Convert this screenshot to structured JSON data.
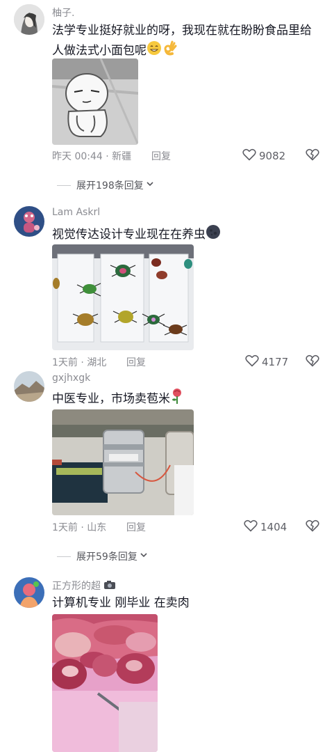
{
  "comments": [
    {
      "username": "柚子.",
      "text": "法学专业挺好就业的呀，我现在就在盼盼食品里给人做法式小面包呢",
      "meta": "昨天 00:44 · 新疆",
      "reply": "回复",
      "likes": "9082",
      "emojis": [
        "grin-emoji",
        "ok-hand-emoji"
      ]
    },
    {
      "username": "Lam Askrl",
      "text": "视觉传达设计专业现在在养虫",
      "meta": "1天前 · 湖北",
      "reply": "回复",
      "likes": "4177",
      "emojis": [
        "dark-moon-emoji"
      ]
    },
    {
      "username": "gxjhxgk",
      "text": "中医专业，市场卖苞米",
      "meta": "1天前 · 山东",
      "reply": "回复",
      "likes": "1404",
      "emojis": [
        "rose-emoji"
      ]
    },
    {
      "username": "正方形的超",
      "text": "计算机专业 刚毕业 在卖肉",
      "emojis": [
        "camera-emoji"
      ]
    }
  ],
  "expanders": [
    {
      "label": "展开198条回复"
    },
    {
      "label": "展开59条回复"
    }
  ],
  "colors": {
    "meta_gray": "#8a8b91",
    "text": "#161823"
  }
}
